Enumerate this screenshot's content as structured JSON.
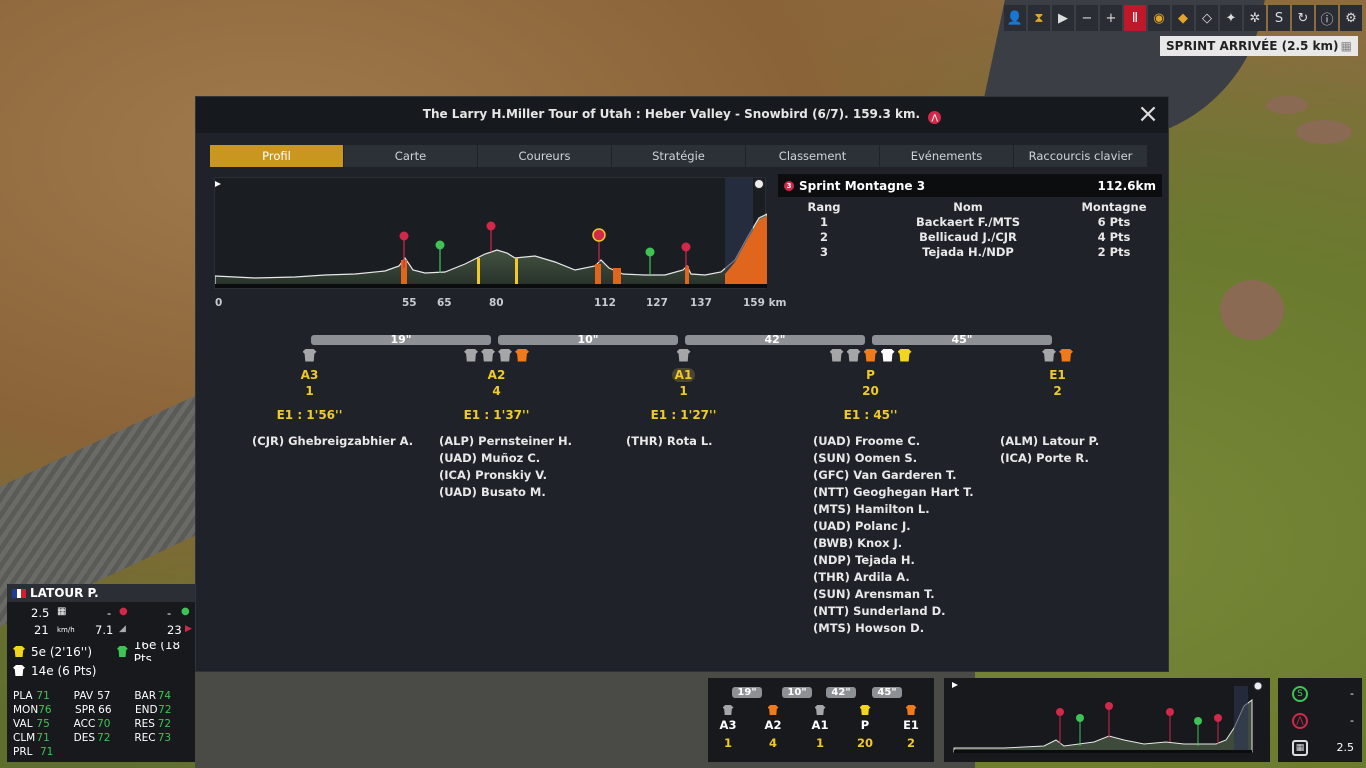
{
  "topbar": {
    "buttons": [
      {
        "name": "rider-view-icon",
        "glyph": "👤"
      },
      {
        "name": "hourglass-icon",
        "glyph": "⧗"
      },
      {
        "name": "play-icon",
        "glyph": "▶"
      },
      {
        "name": "minus-icon",
        "glyph": "−"
      },
      {
        "name": "plus-icon",
        "glyph": "+"
      },
      {
        "name": "pause-icon",
        "glyph": "Ⅱ"
      },
      {
        "name": "eye-icon",
        "glyph": "◉"
      },
      {
        "name": "car-icon",
        "glyph": "◆"
      },
      {
        "name": "moto-icon",
        "glyph": "◇"
      },
      {
        "name": "helicopter-icon",
        "glyph": "✦"
      },
      {
        "name": "wheel-icon",
        "glyph": "✲"
      },
      {
        "name": "sprint-icon",
        "glyph": "S"
      },
      {
        "name": "refresh-icon",
        "glyph": "↻"
      },
      {
        "name": "info-icon",
        "glyph": "ⓘ"
      },
      {
        "name": "settings-icon",
        "glyph": "⚙"
      }
    ]
  },
  "sprint_banner": {
    "label": "SPRINT ARRIVÉE  (2.5 km)"
  },
  "panel": {
    "title": "The Larry H.Miller Tour of Utah : Heber Valley - Snowbird (6/7). 159.3 km.",
    "tabs": [
      {
        "label": "Profil",
        "active": true
      },
      {
        "label": "Carte",
        "active": false
      },
      {
        "label": "Coureurs",
        "active": false
      },
      {
        "label": "Stratégie",
        "active": false
      },
      {
        "label": "Classement",
        "active": false
      },
      {
        "label": "Evénements",
        "active": false
      },
      {
        "label": "Raccourcis clavier",
        "active": false
      }
    ],
    "profile_km_labels": [
      "0",
      "55",
      "65",
      "80",
      "112",
      "127",
      "137",
      "159 km"
    ],
    "sprint_box": {
      "title": "Sprint Montagne 3",
      "distance": "112.6km",
      "icon_text": "3",
      "headers": {
        "rank": "Rang",
        "name": "Nom",
        "points": "Montagne"
      },
      "rows": [
        {
          "rank": "1",
          "name": "Backaert F./MTS",
          "points": "6 Pts"
        },
        {
          "rank": "2",
          "name": "Bellicaud J./CJR",
          "points": "4 Pts"
        },
        {
          "rank": "3",
          "name": "Tejada H./NDP",
          "points": "2 Pts"
        }
      ]
    },
    "gaps": [
      "19\"",
      "10\"",
      "42\"",
      "45\""
    ],
    "groups": [
      {
        "code": "A3",
        "count": "1",
        "time": "E1 : 1'56''",
        "jerseys": [
          "#a4a6a8"
        ],
        "riders": [
          "(CJR) Ghebreigzabhier A."
        ]
      },
      {
        "code": "A2",
        "count": "4",
        "time": "E1 : 1'37''",
        "jerseys": [
          "#a4a6a8",
          "#a4a6a8",
          "#a4a6a8",
          "#f07a1a"
        ],
        "riders": [
          "(ALP) Pernsteiner H.",
          "(UAD) Muñoz C.",
          "(ICA) Pronskiy V.",
          "(UAD) Busato M."
        ]
      },
      {
        "code": "A1",
        "count": "1",
        "time": "E1 : 1'27''",
        "jerseys": [
          "#a4a6a8"
        ],
        "riders": [
          "(THR) Rota L."
        ],
        "highlight": true
      },
      {
        "code": "P",
        "count": "20",
        "time": "E1 : 45''",
        "jerseys": [
          "#a4a6a8",
          "#a4a6a8",
          "#f07a1a",
          "#ffffff",
          "#f2d51e"
        ],
        "riders": [
          "(UAD) Froome C.",
          "(SUN) Oomen S.",
          "(GFC) Van Garderen T.",
          "(NTT) Geoghegan Hart T.",
          "(MTS) Hamilton L.",
          "(UAD) Polanc J.",
          "(BWB) Knox J.",
          "(NDP) Tejada H.",
          "(THR) Ardila A.",
          "(SUN) Arensman T.",
          "(NTT) Sunderland D.",
          "(MTS) Howson D."
        ]
      },
      {
        "code": "E1",
        "count": "2",
        "time": "",
        "jerseys": [
          "#a4a6a8",
          "#f07a1a"
        ],
        "riders": [
          "(ALM) Latour P.",
          "(ICA) Porte R."
        ]
      }
    ]
  },
  "rider_card": {
    "name": "LATOUR P.",
    "dist": "2.5",
    "speed": "21",
    "speed_unit": "km/h",
    "gradient": "7.1",
    "kom_val": "-",
    "sprint_val": "-",
    "position": "23",
    "gc": "5e (2'16'')",
    "points": "16e (18 Pts",
    "youth": "14e (6 Pts)",
    "skills": [
      [
        {
          "k": "PLA",
          "v": "71"
        },
        {
          "k": "PAV",
          "v": "57",
          "w": true
        },
        {
          "k": "BAR",
          "v": "74"
        }
      ],
      [
        {
          "k": "MON",
          "v": "76"
        },
        {
          "k": "SPR",
          "v": "66",
          "w": true
        },
        {
          "k": "END",
          "v": "72"
        }
      ],
      [
        {
          "k": "VAL",
          "v": "75"
        },
        {
          "k": "ACC",
          "v": "70"
        },
        {
          "k": "RES",
          "v": "72"
        }
      ],
      [
        {
          "k": "CLM",
          "v": "71"
        },
        {
          "k": "DES",
          "v": "72"
        },
        {
          "k": "REC",
          "v": "73"
        }
      ],
      [
        {
          "k": "PRL",
          "v": "71"
        }
      ]
    ]
  },
  "mini_groups": {
    "gaps": [
      "19\"",
      "10\"",
      "42\"",
      "45\""
    ],
    "cols": [
      {
        "code": "A3",
        "count": "1"
      },
      {
        "code": "A2",
        "count": "4"
      },
      {
        "code": "A1",
        "count": "1"
      },
      {
        "code": "P",
        "count": "20"
      },
      {
        "code": "E1",
        "count": "2"
      }
    ]
  },
  "mini_side": {
    "sprint_val": "-",
    "kom_val": "-",
    "finish_val": "2.5"
  },
  "colors": {
    "accent": "#c9961f",
    "panel": "#1f2329",
    "yellow_text": "#f0c92a",
    "kom_red": "#d2284a",
    "sprint_green": "#3ec455"
  }
}
